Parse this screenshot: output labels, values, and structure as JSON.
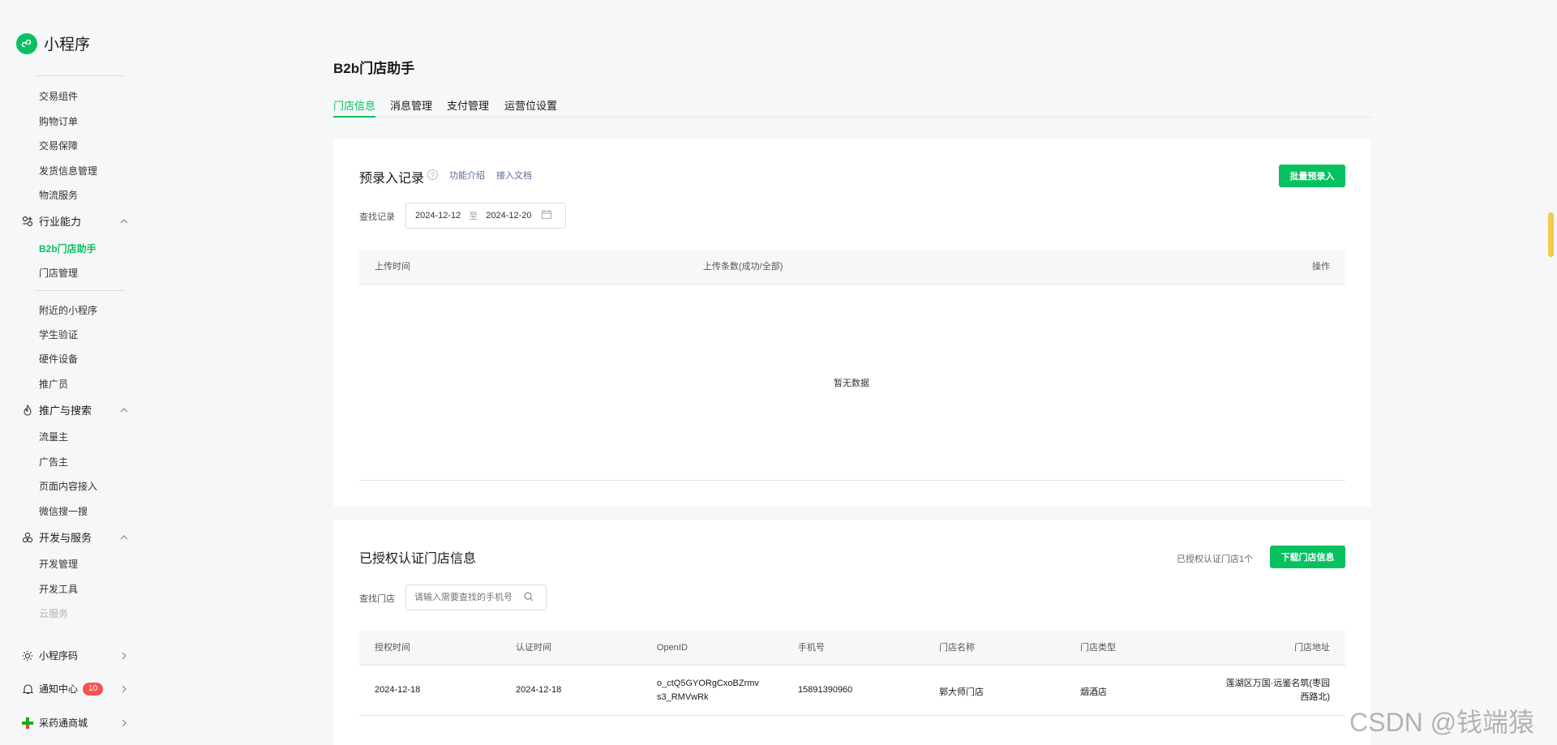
{
  "sidebar": {
    "app_name": "小程序",
    "trade_items": [
      "交易组件",
      "购物订单",
      "交易保障",
      "发货信息管理",
      "物流服务"
    ],
    "industry": {
      "label": "行业能力",
      "items": [
        "B2b门店助手",
        "门店管理"
      ]
    },
    "other_items": [
      "附近的小程序",
      "学生验证",
      "硬件设备",
      "推广员"
    ],
    "promo": {
      "label": "推广与搜索",
      "items": [
        "流量主",
        "广告主",
        "页面内容接入",
        "微信搜一搜"
      ]
    },
    "dev": {
      "label": "开发与服务",
      "items": [
        "开发管理",
        "开发工具",
        "云服务"
      ]
    },
    "code": {
      "label": "小程序码"
    },
    "notify": {
      "label": "通知中心",
      "badge": "10"
    },
    "mall": {
      "label": "采药通商城"
    }
  },
  "page": {
    "title": "B2b门店助手",
    "tabs": [
      "门店信息",
      "消息管理",
      "支付管理",
      "运营位设置"
    ]
  },
  "prerecord": {
    "title": "预录入记录",
    "help": "?",
    "link_intro": "功能介绍",
    "link_doc": "接入文档",
    "batch_button": "批量预录入",
    "search_label": "查找记录",
    "date_start": "2024-12-12",
    "date_sep": "至",
    "date_end": "2024-12-20",
    "columns": [
      "上传时间",
      "上传条数(成功/全部)",
      "操作"
    ],
    "empty": "暂无数据"
  },
  "stores": {
    "title": "已授权认证门店信息",
    "count_text": "已授权认证门店1个",
    "download_button": "下载门店信息",
    "search_label": "查找门店",
    "search_placeholder": "请输入需要查找的手机号",
    "columns": [
      "授权时间",
      "认证时间",
      "OpenID",
      "手机号",
      "门店名称",
      "门店类型",
      "门店地址"
    ],
    "rows": [
      {
        "auth_time": "2024-12-18",
        "cert_time": "2024-12-18",
        "openid_1": "o_ctQ5GYORgCxoBZrmv",
        "openid_2": "s3_RMVwRk",
        "phone": "15891390960",
        "name": "郭大师门店",
        "type": "烟酒店",
        "addr_1": "莲湖区万国·远鉴名筑(枣园",
        "addr_2": "西路北)"
      }
    ]
  },
  "watermark": "CSDN @钱端猿",
  "colors": {
    "accent": "#07c160",
    "link": "#576b95",
    "badge": "#fa5151"
  }
}
